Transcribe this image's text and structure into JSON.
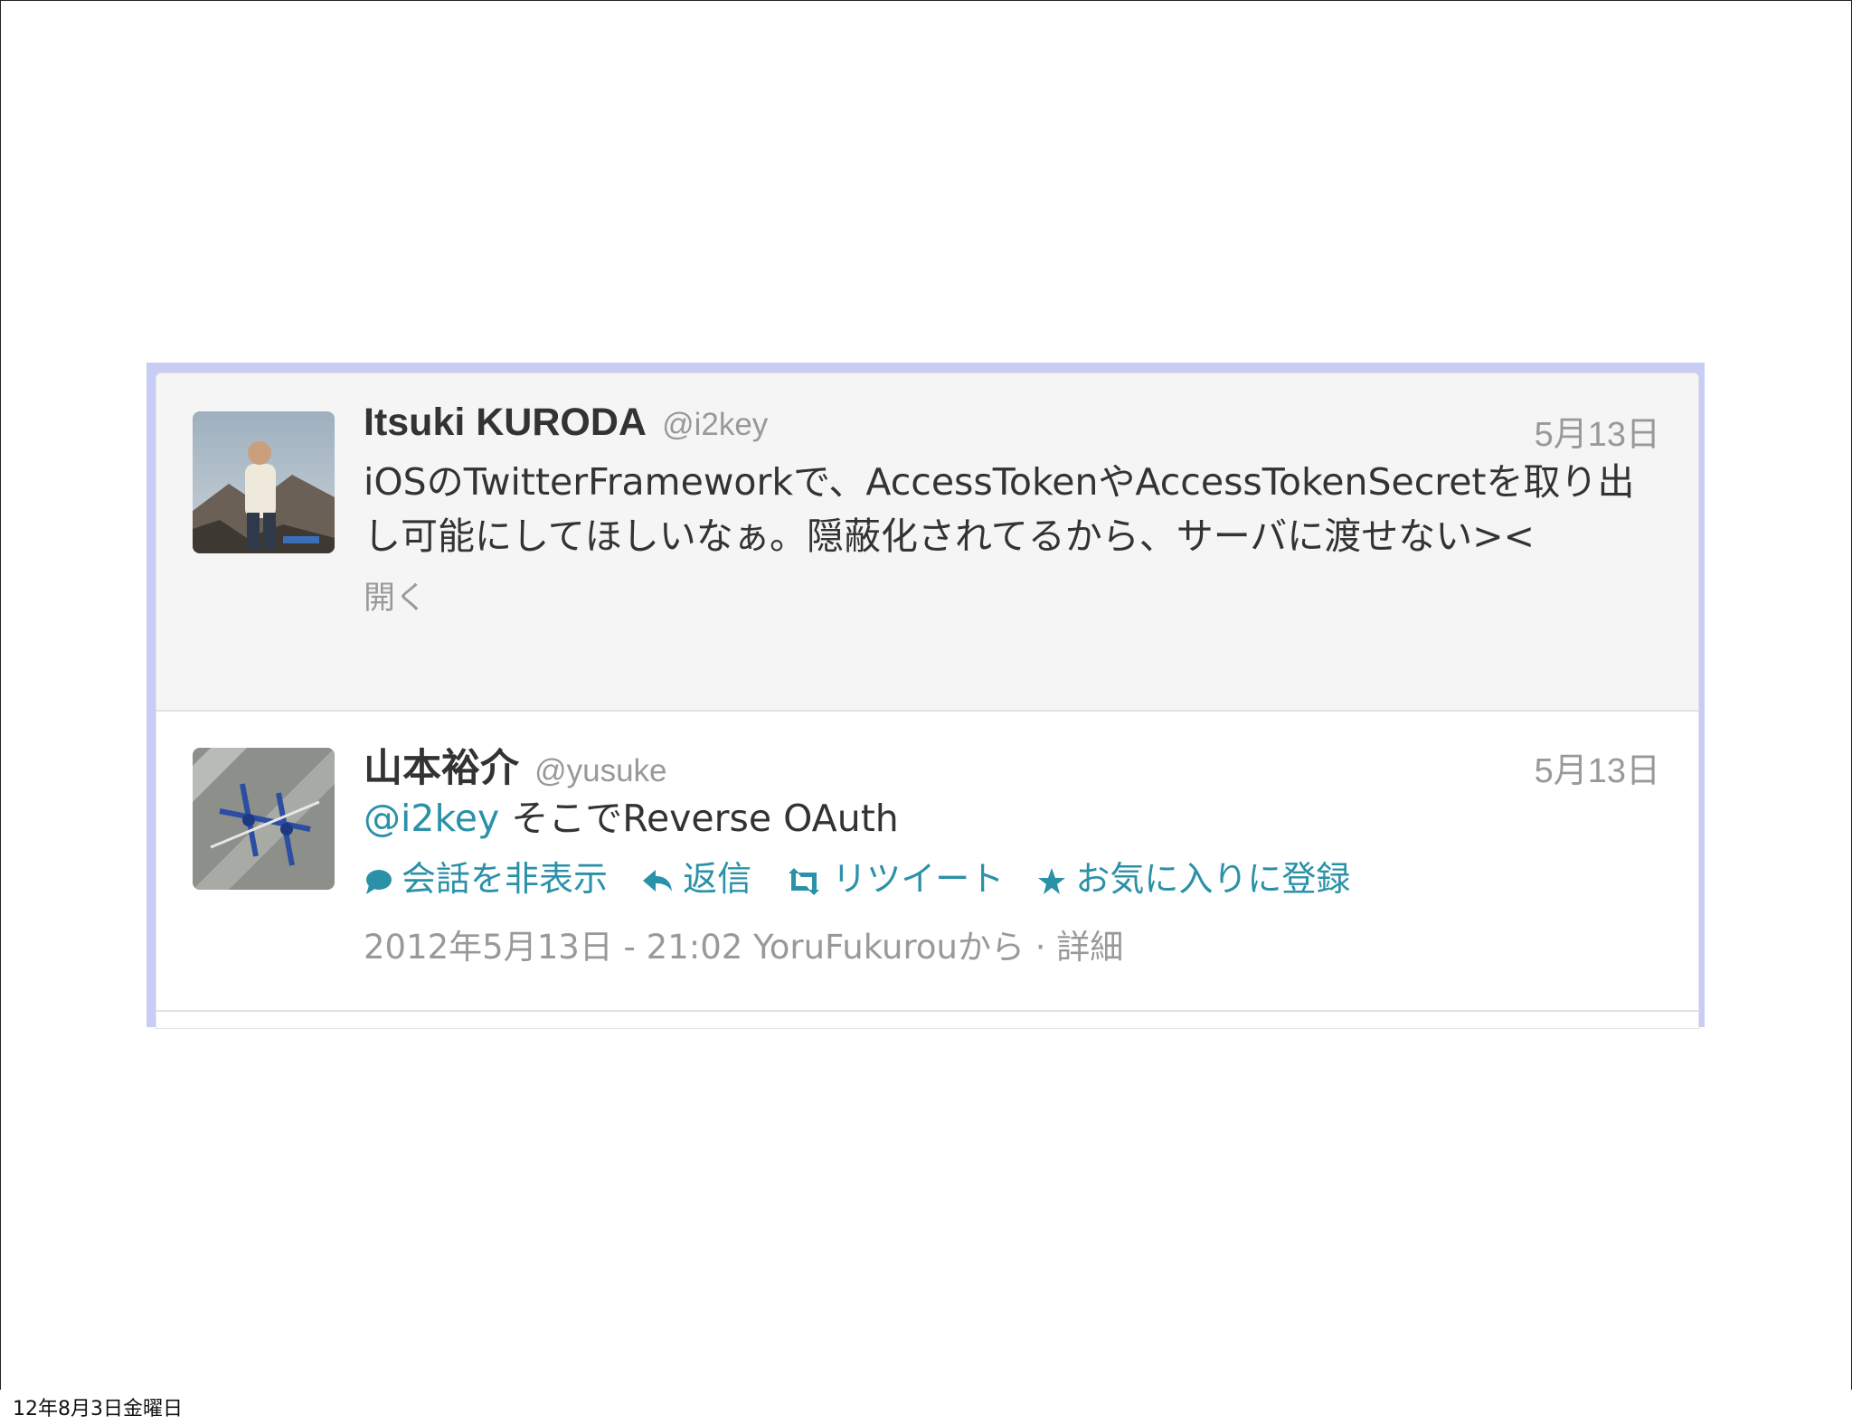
{
  "tweets": [
    {
      "name": "Itsuki KURODA",
      "handle": "@i2key",
      "date": "5月13日",
      "text": "iOSのTwitterFrameworkで、AccessTokenやAccessTokenSecretを取り出し可能にしてほしいなぁ。隠蔽化されてるから、サーバに渡せない><",
      "expand_label": "開く"
    },
    {
      "name": "山本裕介",
      "handle": "@yusuke",
      "date": "5月13日",
      "mention": "@i2key",
      "text": "そこでReverse OAuth",
      "actions": {
        "hide_conversation": "会話を非表示",
        "reply": "返信",
        "retweet": "リツイート",
        "favorite": "お気に入りに登録"
      },
      "meta": "2012年5月13日 - 21:02 YoruFukurouから · 詳細"
    }
  ],
  "footer": {
    "date": "12年8月3日金曜日"
  },
  "colors": {
    "link": "#2a91a8",
    "muted": "#999999",
    "frame": "#c7cdf4"
  },
  "icons": [
    "speech-bubble-icon",
    "reply-arrow-icon",
    "retweet-icon",
    "star-icon"
  ]
}
